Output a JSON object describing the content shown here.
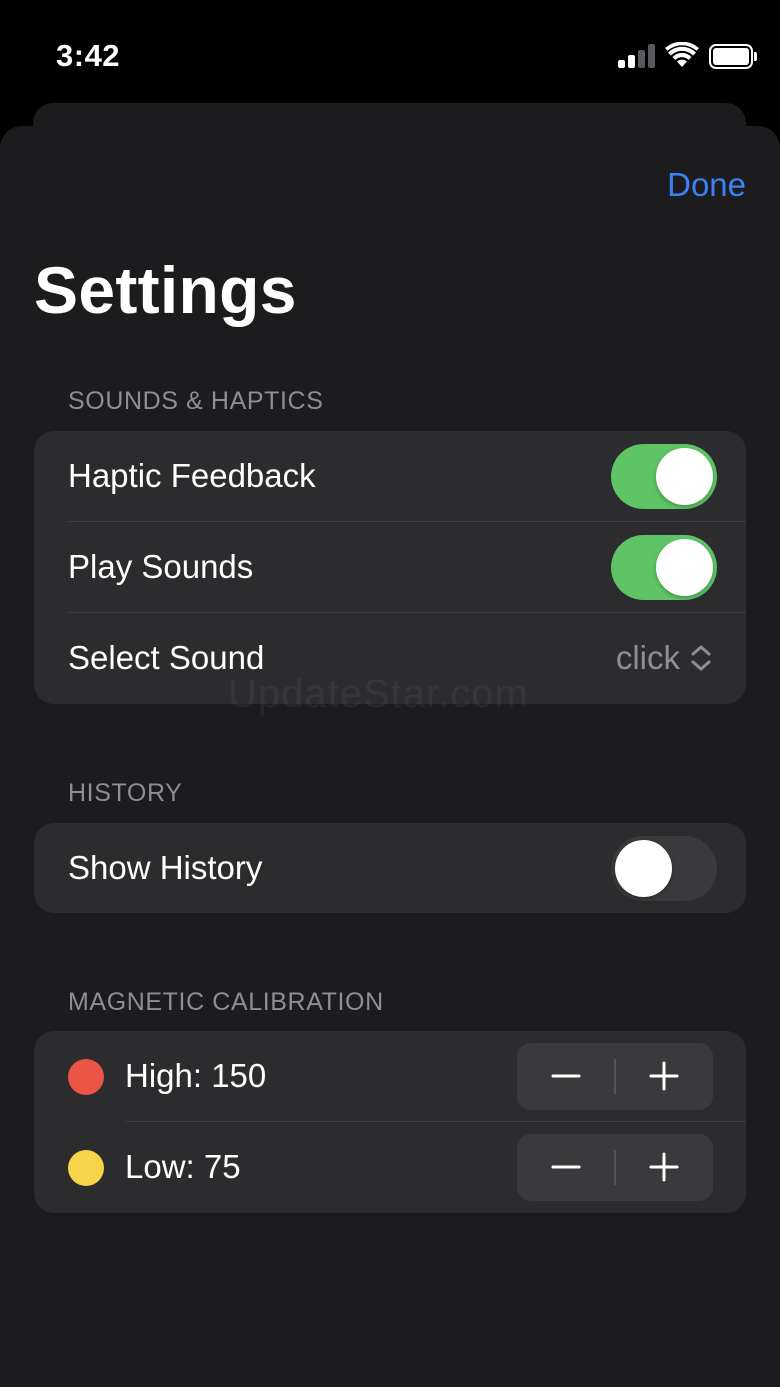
{
  "status_bar": {
    "time": "3:42",
    "signal_icon": "signal-icon",
    "wifi_icon": "wifi-icon",
    "battery_icon": "battery-icon"
  },
  "header": {
    "done_label": "Done",
    "title": "Settings"
  },
  "sections": {
    "sounds": {
      "header": "SOUNDS & HAPTICS",
      "haptic": {
        "label": "Haptic Feedback",
        "on": true
      },
      "play_sounds": {
        "label": "Play Sounds",
        "on": true
      },
      "select_sound": {
        "label": "Select Sound",
        "value": "click"
      }
    },
    "history": {
      "header": "HISTORY",
      "show_history": {
        "label": "Show History",
        "on": false
      }
    },
    "calibration": {
      "header": "MAGNETIC CALIBRATION",
      "high": {
        "label": "High: 150",
        "color": "#eb5545"
      },
      "low": {
        "label": "Low: 75",
        "color": "#f7d548"
      }
    }
  },
  "watermark": "UpdateStar.com",
  "colors": {
    "accent": "#3b82f6",
    "toggle_on": "#5ec466"
  }
}
